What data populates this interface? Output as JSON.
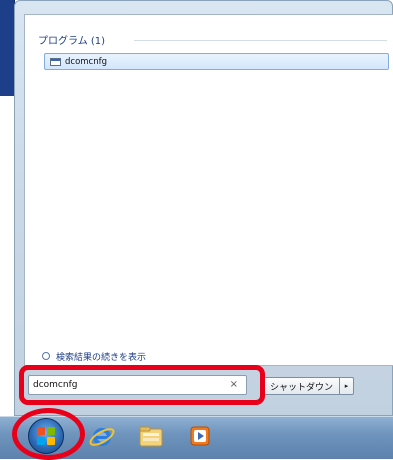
{
  "start_menu": {
    "section_header": "プログラム (1)",
    "results": [
      {
        "label": "dcomcnfg",
        "icon": "program-window-icon"
      }
    ],
    "more_results_label": "検索結果の続きを表示",
    "search": {
      "value": "dcomcnfg",
      "clear_glyph": "×"
    },
    "shutdown_label": "シャットダウン",
    "shutdown_arrow_glyph": "▸"
  },
  "taskbar": {
    "icons": [
      "windows-start-orb-icon",
      "internet-explorer-icon",
      "windows-explorer-icon",
      "media-player-icon"
    ]
  },
  "annotations": {
    "highlight_color": "#e8001a"
  }
}
